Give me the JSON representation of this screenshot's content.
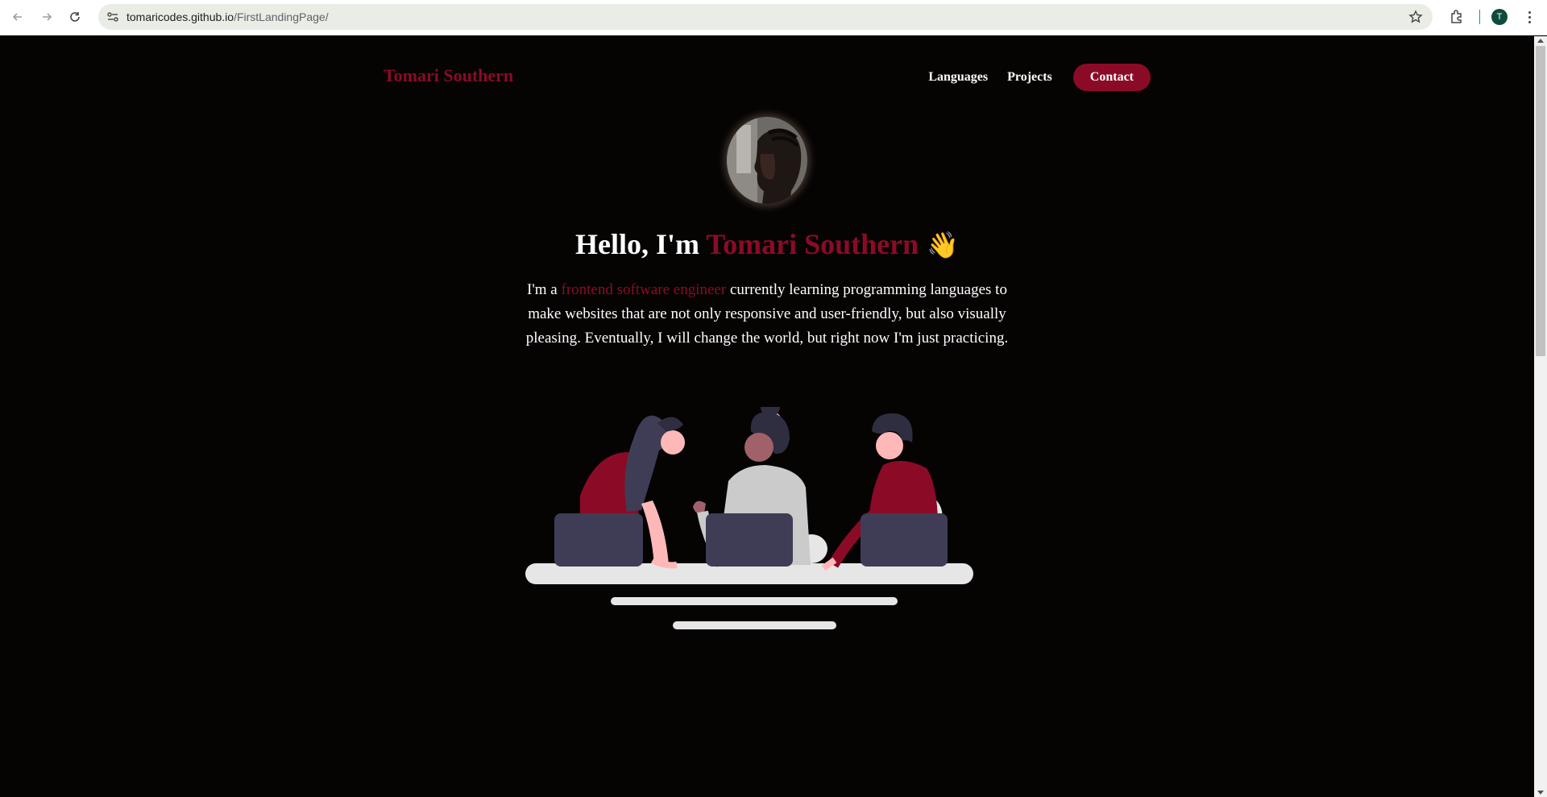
{
  "browser": {
    "url_host": "tomaricodes.github.io",
    "url_path": "/FirstLandingPage/",
    "profile_initial": "T"
  },
  "header": {
    "brand": "Tomari Southern",
    "nav": [
      {
        "label": "Languages"
      },
      {
        "label": "Projects"
      },
      {
        "label": "Contact"
      }
    ]
  },
  "hero": {
    "greeting_prefix": "Hello, I'm ",
    "greeting_name": "Tomari Southern",
    "wave_emoji": "👋",
    "intro_prefix": "I'm a ",
    "intro_highlight": "frontend software engineer",
    "intro_rest": " currently learning programming languages to make websites that are not only responsive and user-friendly, but also visually pleasing. Eventually, I will change the world, but right now I'm just practicing."
  },
  "colors": {
    "accent": "#8b0b26",
    "background": "#060303",
    "text": "#ffffff"
  }
}
